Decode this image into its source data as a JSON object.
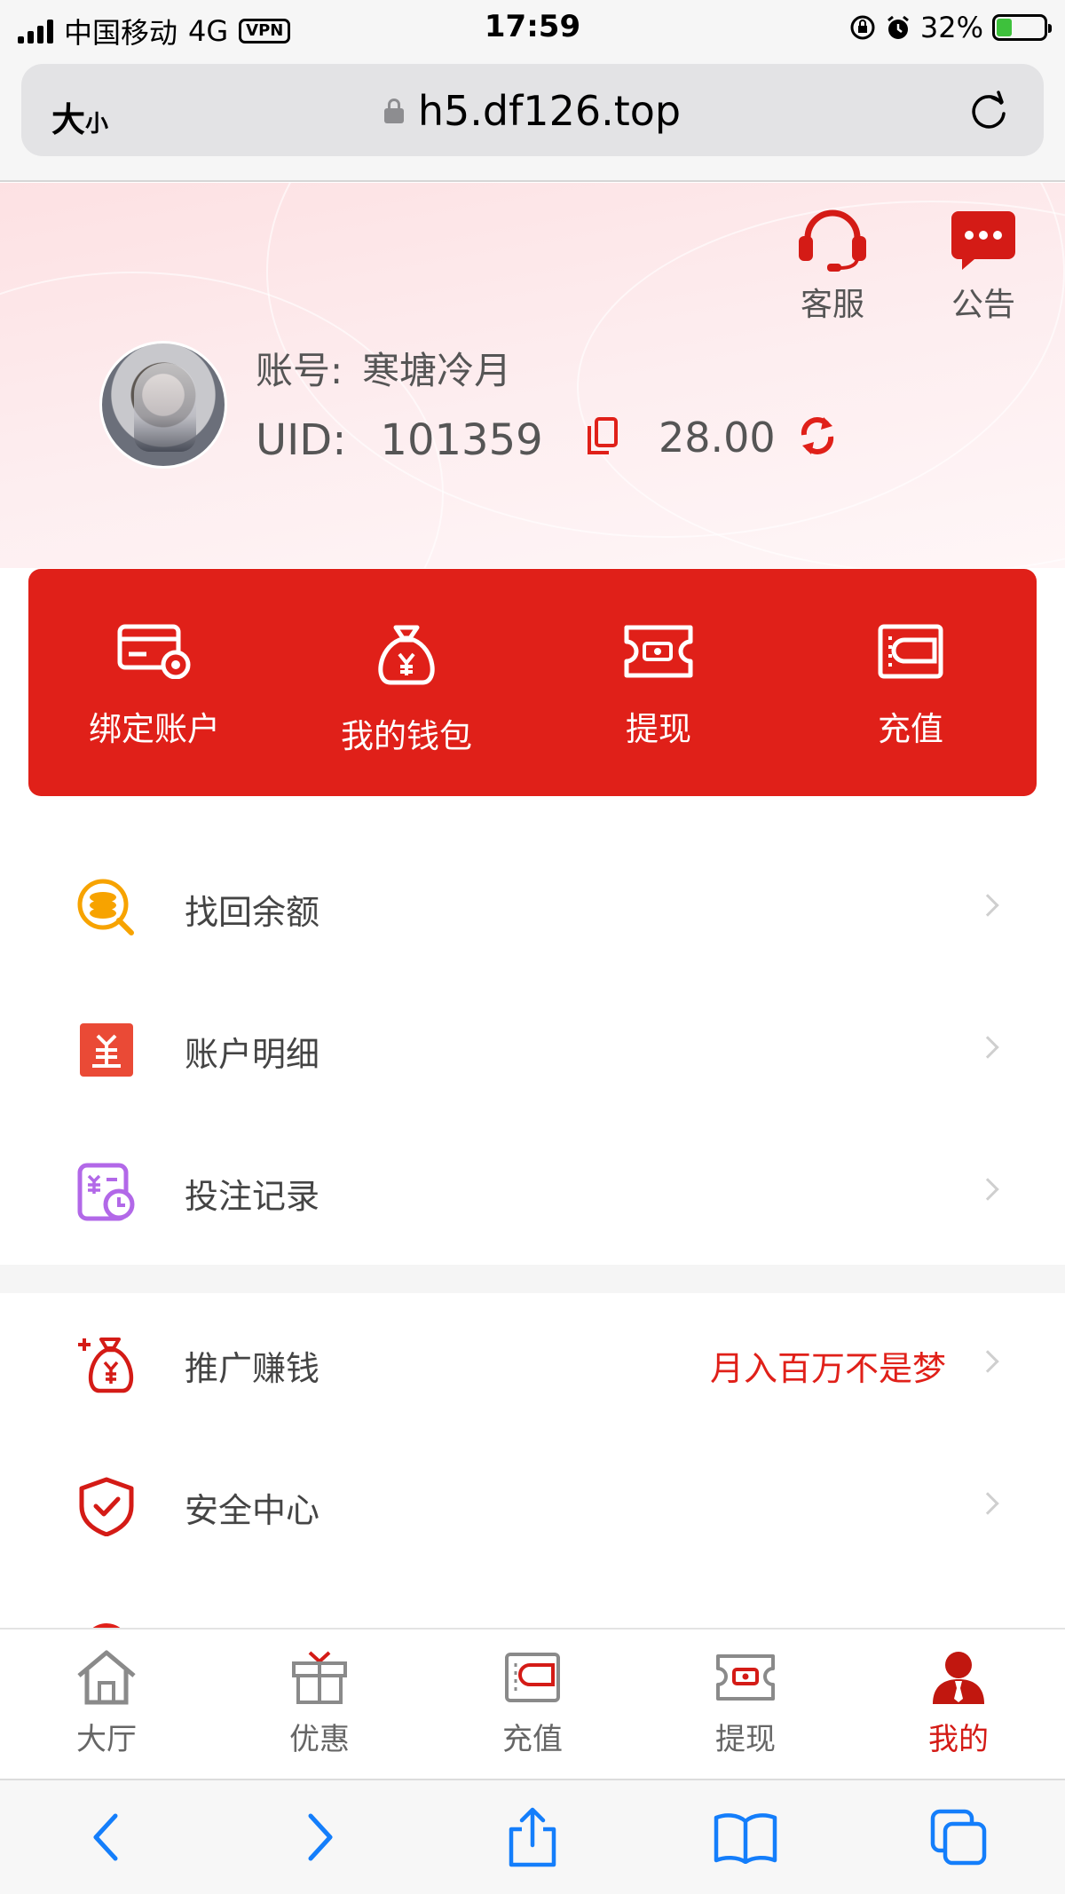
{
  "status_bar": {
    "carrier": "中国移动",
    "network": "4G",
    "vpn": "VPN",
    "time": "17:59",
    "battery": "32%"
  },
  "browser": {
    "text_size_label_big": "大",
    "text_size_label_small": "小",
    "url": "h5.df126.top"
  },
  "header": {
    "service_label": "客服",
    "notice_label": "公告"
  },
  "profile": {
    "account_label": "账号:",
    "account_name": "寒塘冷月",
    "uid_label": "UID:",
    "uid": "101359",
    "balance": "28.00"
  },
  "actions": [
    {
      "label": "绑定账户",
      "icon": "bind-account-icon"
    },
    {
      "label": "我的钱包",
      "icon": "wallet-bag-icon"
    },
    {
      "label": "提现",
      "icon": "withdraw-icon"
    },
    {
      "label": "充值",
      "icon": "deposit-icon"
    }
  ],
  "menu_group_1": [
    {
      "label": "找回余额",
      "icon": "recover-balance-icon"
    },
    {
      "label": "账户明细",
      "icon": "account-detail-icon"
    },
    {
      "label": "投注记录",
      "icon": "bet-record-icon"
    }
  ],
  "menu_group_2": [
    {
      "label": "推广赚钱",
      "icon": "promote-icon",
      "extra": "月入百万不是梦"
    },
    {
      "label": "安全中心",
      "icon": "security-shield-icon"
    }
  ],
  "tabs": [
    {
      "label": "大厅",
      "icon": "home-icon"
    },
    {
      "label": "优惠",
      "icon": "gift-icon"
    },
    {
      "label": "充值",
      "icon": "deposit-icon"
    },
    {
      "label": "提现",
      "icon": "withdraw-icon"
    },
    {
      "label": "我的",
      "icon": "user-icon",
      "active": true
    }
  ],
  "colors": {
    "primary_red": "#e02019",
    "active_tab": "#d41b16",
    "safari_blue": "#147efb"
  }
}
